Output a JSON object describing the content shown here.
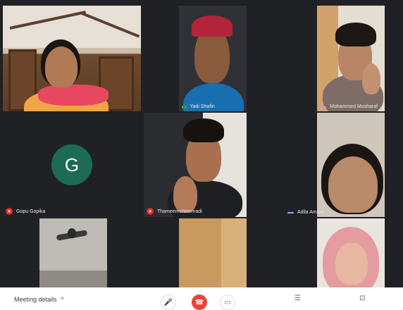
{
  "participants": [
    {
      "name": ""
    },
    {
      "name": "Yadi Shafin"
    },
    {
      "name": "Mohammed Musharaf"
    },
    {
      "name": "Gopu Gopika",
      "initial": "G"
    },
    {
      "name": "Thameemchemmadi"
    },
    {
      "name": "Adila Ammu"
    },
    {
      "name": ""
    },
    {
      "name": ""
    },
    {
      "name": ""
    }
  ],
  "toolbar": {
    "meeting_details_label": "Meeting details",
    "chevron": "^"
  },
  "colors": {
    "background": "#202124",
    "muted_red": "#d93025",
    "avatar_green": "#1e6b53",
    "speaking_blue": "#8ab4f8"
  }
}
